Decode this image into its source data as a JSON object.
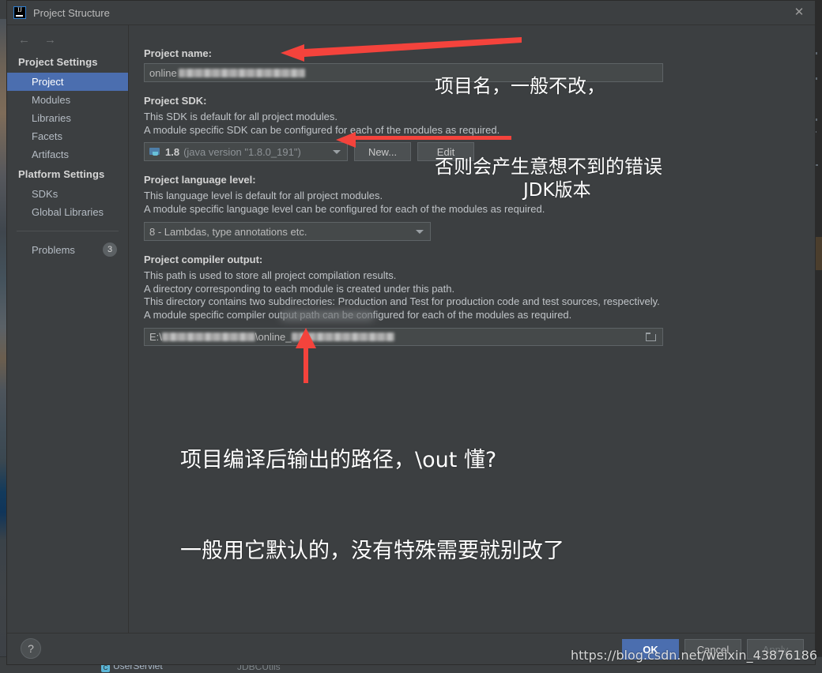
{
  "window": {
    "title": "Project Structure",
    "logo_icon": "intellij-idea-icon",
    "close_icon": "close-icon"
  },
  "sidebar": {
    "back_icon": "arrow-left-icon",
    "forward_icon": "arrow-right-icon",
    "groups": [
      {
        "title": "Project Settings",
        "items": [
          {
            "label": "Project",
            "selected": true
          },
          {
            "label": "Modules",
            "selected": false
          },
          {
            "label": "Libraries",
            "selected": false
          },
          {
            "label": "Facets",
            "selected": false
          },
          {
            "label": "Artifacts",
            "selected": false
          }
        ]
      },
      {
        "title": "Platform Settings",
        "items": [
          {
            "label": "SDKs",
            "selected": false
          },
          {
            "label": "Global Libraries",
            "selected": false
          }
        ]
      }
    ],
    "problems": {
      "label": "Problems",
      "count": "3"
    }
  },
  "main": {
    "project_name": {
      "title": "Project name:",
      "value": "online",
      "redacted": true
    },
    "project_sdk": {
      "title": "Project SDK:",
      "desc_line1": "This SDK is default for all project modules.",
      "desc_line2": "A module specific SDK can be configured for each of the modules as required.",
      "value_bold": "1.8",
      "value_rest": "(java version \"1.8.0_191\")",
      "folder_icon": "java-sdk-folder-icon",
      "dropdown_icon": "chevron-down-icon",
      "new_button": "New...",
      "edit_button": "Edit"
    },
    "language_level": {
      "title": "Project language level:",
      "desc_line1": "This language level is default for all project modules.",
      "desc_line2": "A module specific language level can be configured for each of the modules as required.",
      "value": "8 - Lambdas, type annotations etc.",
      "dropdown_icon": "chevron-down-icon"
    },
    "compiler_output": {
      "title": "Project compiler output:",
      "desc_line1": "This path is used to store all project compilation results.",
      "desc_line2": "A directory corresponding to each module is created under this path.",
      "desc_line3": "This directory contains two subdirectories: Production and Test for production code and test sources, respectively.",
      "desc_line4": "A module specific compiler output path can be configured for each of the modules as required.",
      "value_prefix": "E:\\",
      "value_middle": "\\online_",
      "browse_icon": "browse-folder-icon"
    }
  },
  "footer": {
    "help_icon": "help-question-icon",
    "ok_button": "OK",
    "cancel_button": "Cancel",
    "apply_button": "Apply"
  },
  "annotations": [
    {
      "name": "project-name-note",
      "line1": "项目名，一般不改，",
      "line2": "否则会产生意想不到的错误"
    },
    {
      "name": "jdk-version-note",
      "line1": "JDK版本"
    },
    {
      "name": "compiler-output-note",
      "line1": "项目编译后输出的路径，\\out 懂?",
      "line2": "一般用它默认的，没有特殊需要就别改了"
    }
  ],
  "watermark": "https://blog.csdn.net/weixin_43876186",
  "ide_background": {
    "tabs": [
      "UserServlet",
      "JDBCUtils"
    ]
  },
  "colors": {
    "accent": "#4b6eaf",
    "dialog_bg": "#3c3f41",
    "field_bg": "#45494a",
    "annotation": "#ffffff",
    "arrow_red": "#f4433c"
  }
}
